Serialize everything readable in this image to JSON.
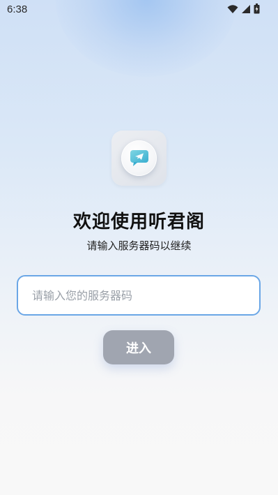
{
  "status_bar": {
    "time": "6:38",
    "icons": [
      "wifi-icon",
      "cellular-signal-icon",
      "battery-icon"
    ]
  },
  "app_icon": {
    "icon": "message-send-icon",
    "accent": "#4cc3d9"
  },
  "welcome": {
    "title": "欢迎使用听君阁",
    "subtitle": "请输入服务器码以继续"
  },
  "server_code_input": {
    "value": "",
    "placeholder": "请输入您的服务器码"
  },
  "enter_button": {
    "label": "进入"
  },
  "colors": {
    "input_border": "#6aa6e6",
    "button_bg": "#a0a5b0",
    "background_top": "#cfe0f6"
  }
}
